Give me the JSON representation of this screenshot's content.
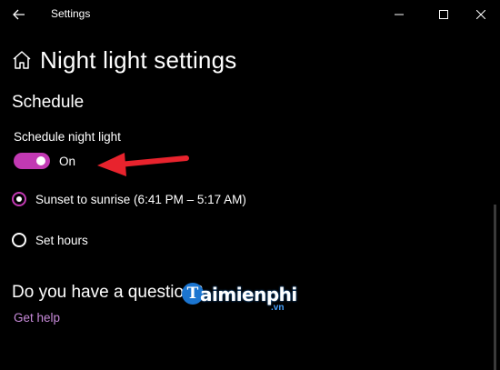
{
  "window": {
    "app_title": "Settings",
    "icons": {
      "back": "arrow-left-icon",
      "minimize": "minimize-icon",
      "maximize": "maximize-icon",
      "close": "close-icon"
    }
  },
  "header": {
    "title": "Night light settings",
    "icon": "home-icon"
  },
  "schedule": {
    "section_title": "Schedule",
    "toggle_label": "Schedule night light",
    "toggle_state": "On",
    "toggle_on": true,
    "accent_color": "#c239b3",
    "options": [
      {
        "label": "Sunset to sunrise (6:41 PM – 5:17 AM)",
        "checked": true
      },
      {
        "label": "Set hours",
        "checked": false
      }
    ]
  },
  "help": {
    "question": "Do you have a question?",
    "link": "Get help",
    "link_color": "#c78ad9"
  },
  "watermark": {
    "logo_letter": "T",
    "brand": "aimienphi",
    "tld": ".vn"
  },
  "annotation": {
    "arrow_color": "#e8232d"
  }
}
